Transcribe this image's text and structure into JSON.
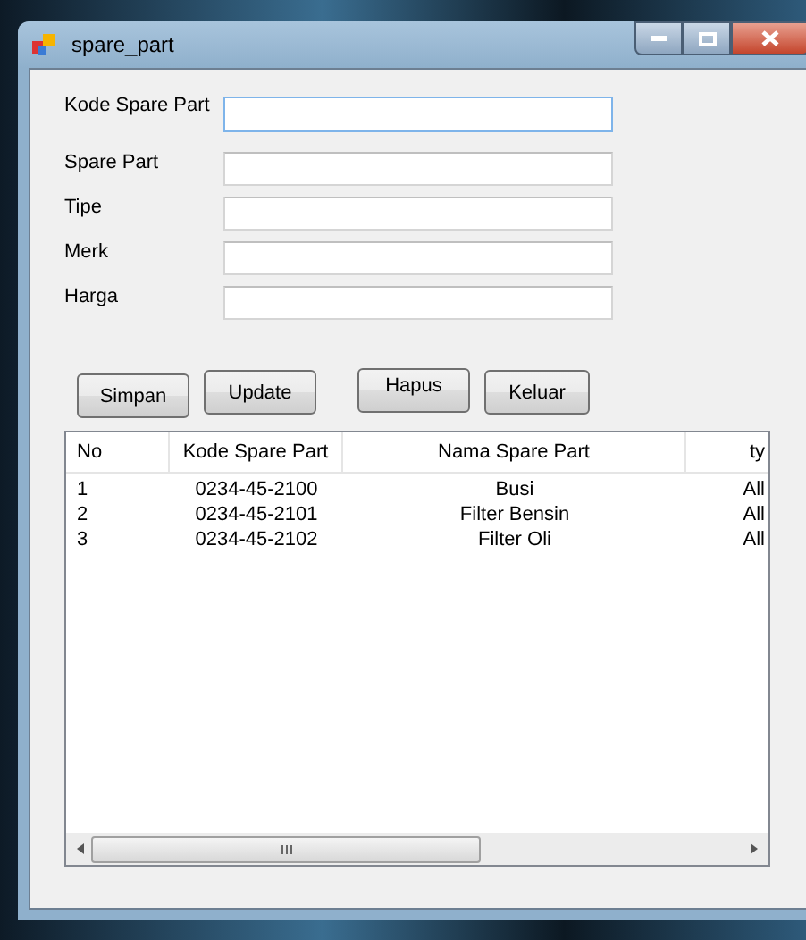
{
  "window": {
    "title": "spare_part"
  },
  "fields": [
    {
      "label": "Kode Spare Part",
      "focused": true
    },
    {
      "label": "Spare Part",
      "focused": false
    },
    {
      "label": "Tipe",
      "focused": false
    },
    {
      "label": "Merk",
      "focused": false
    },
    {
      "label": "Harga",
      "focused": false
    }
  ],
  "buttons": [
    "Simpan",
    "Update",
    "Hapus",
    "Keluar"
  ],
  "table": {
    "columns": [
      "No",
      "Kode Spare Part",
      "Nama Spare Part",
      "ty"
    ],
    "rows": [
      [
        "1",
        "0234-45-2100",
        "Busi",
        "All"
      ],
      [
        "2",
        "0234-45-2101",
        "Filter Bensin",
        "All"
      ],
      [
        "3",
        "0234-45-2102",
        "Filter Oli",
        "All"
      ]
    ]
  }
}
